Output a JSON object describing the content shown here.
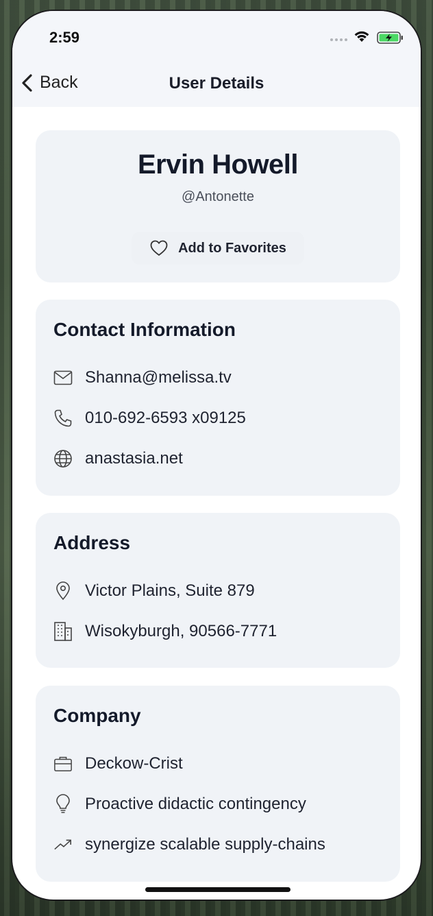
{
  "status": {
    "time": "2:59"
  },
  "nav": {
    "back_label": "Back",
    "title": "User Details"
  },
  "profile": {
    "name": "Ervin Howell",
    "username": "@Antonette",
    "favorite_label": "Add to Favorites"
  },
  "contact": {
    "title": "Contact Information",
    "email": "Shanna@melissa.tv",
    "phone": "010-692-6593 x09125",
    "website": "anastasia.net"
  },
  "address": {
    "title": "Address",
    "street": "Victor Plains, Suite 879",
    "city": "Wisokyburgh, 90566-7771"
  },
  "company": {
    "title": "Company",
    "name": "Deckow-Crist",
    "catch_phrase": "Proactive didactic contingency",
    "bs": "synergize scalable supply-chains"
  },
  "colors": {
    "card_bg": "#f0f3f7",
    "text_primary": "#141a2a",
    "battery_green": "#4cd964"
  }
}
